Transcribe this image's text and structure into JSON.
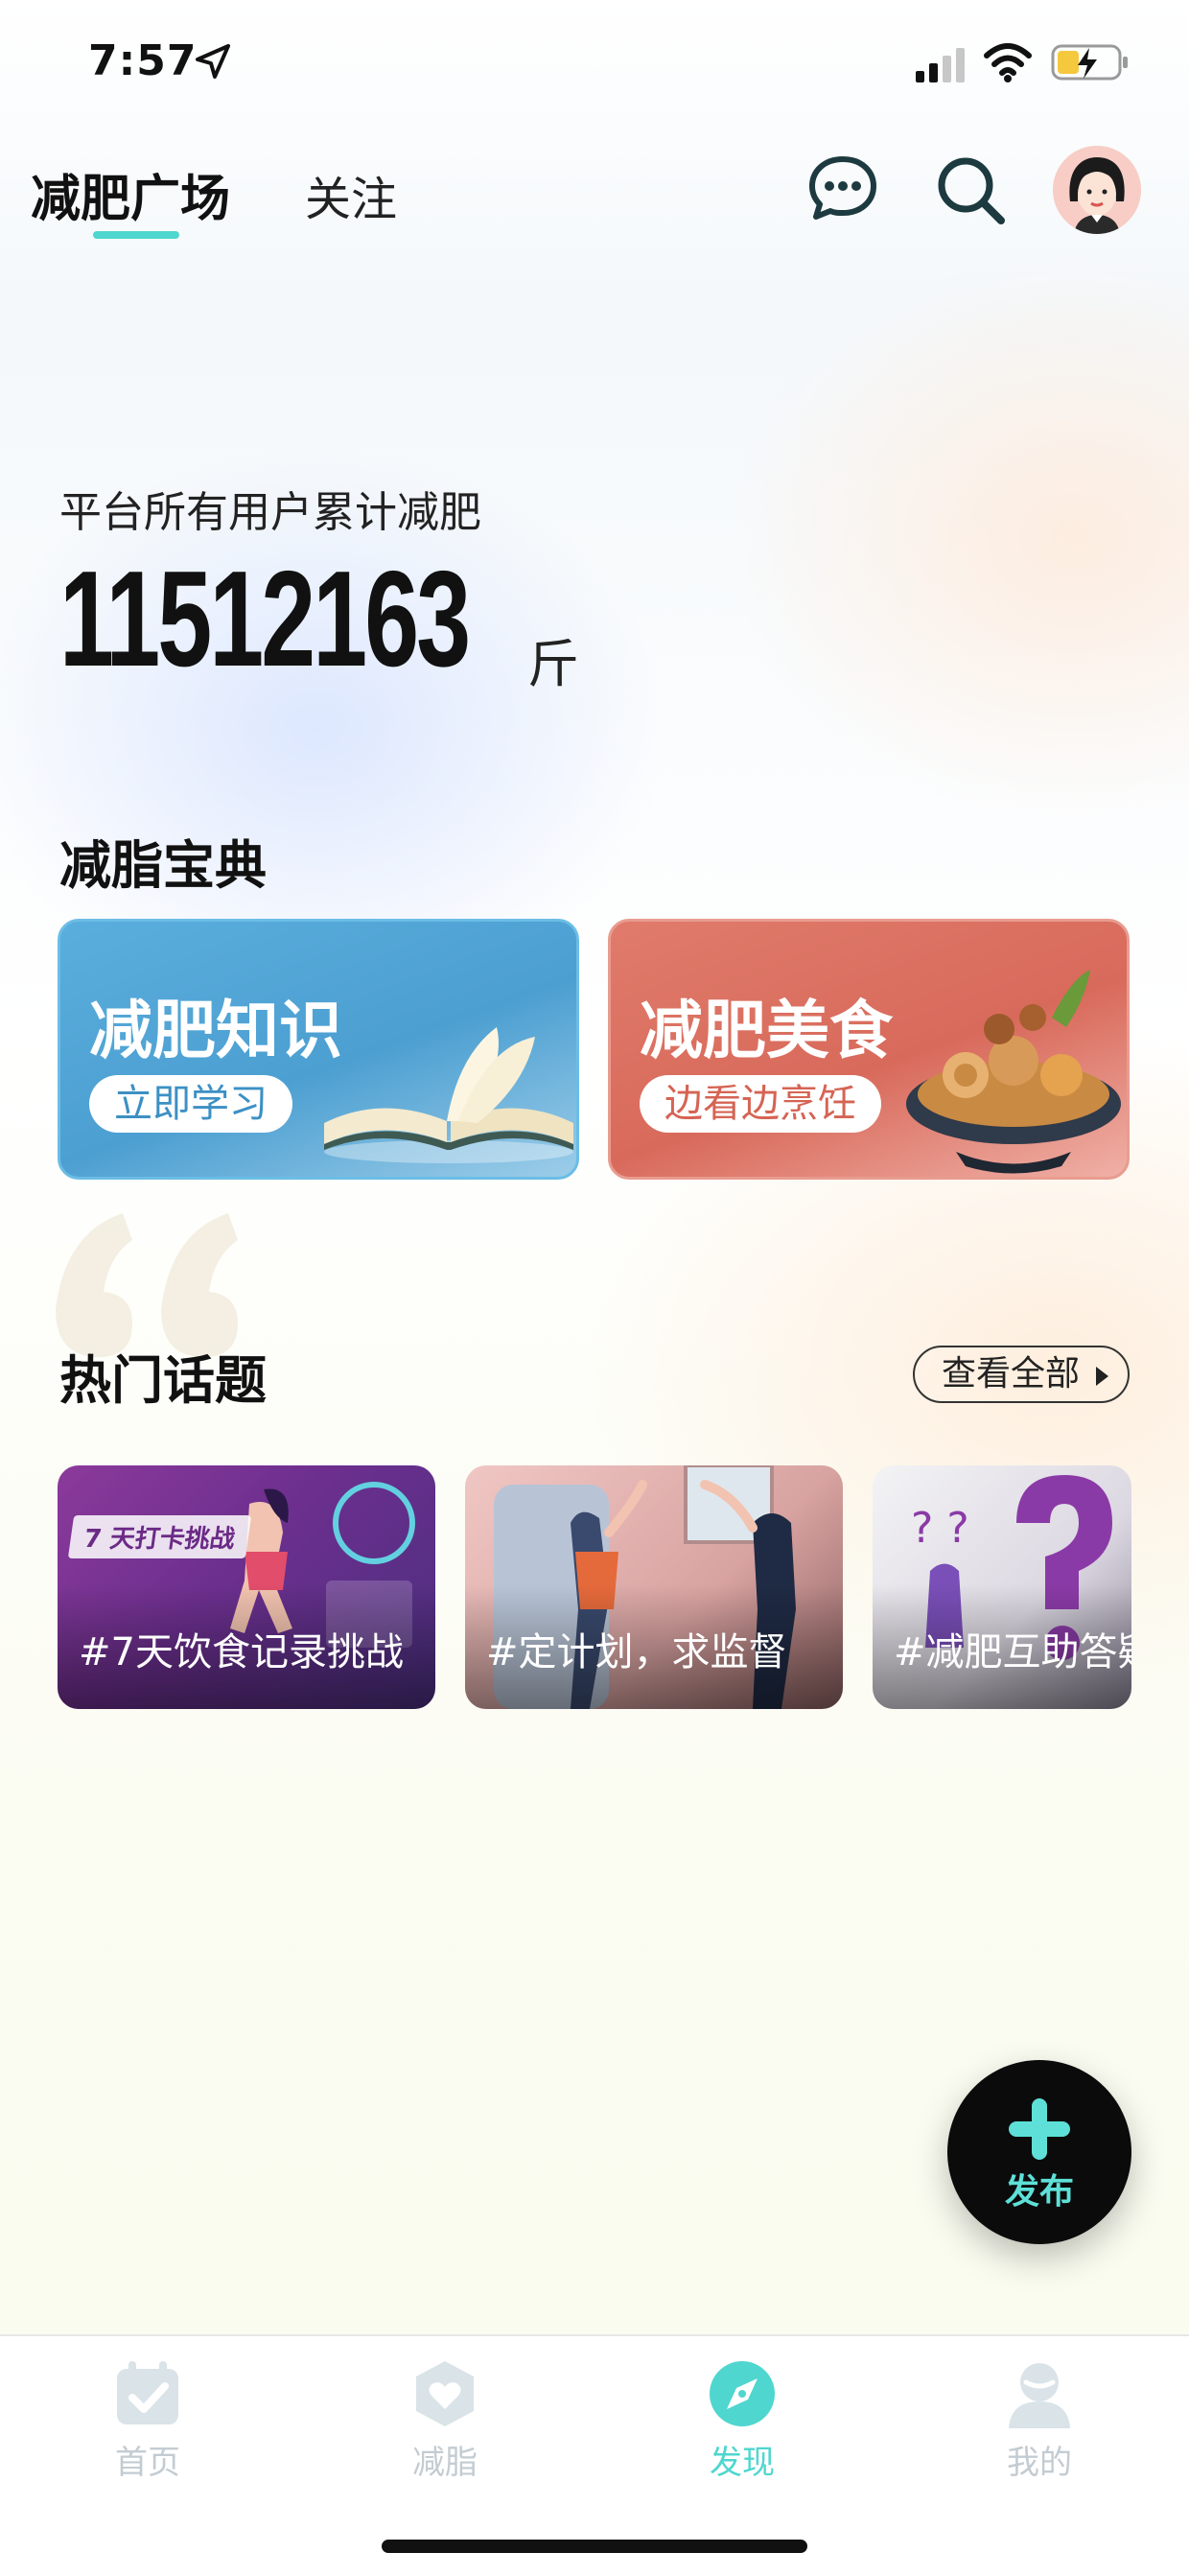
{
  "status_bar": {
    "time": "7:57",
    "icons": [
      "location-arrow-icon",
      "cellular-signal-icon",
      "wifi-icon",
      "battery-charging-icon"
    ]
  },
  "header": {
    "tabs": [
      {
        "label": "减肥广场",
        "active": true
      },
      {
        "label": "关注",
        "active": false
      }
    ],
    "accent_color": "#4fd6cf",
    "icons": [
      "message-icon",
      "search-icon",
      "avatar"
    ]
  },
  "stats": {
    "label": "平台所有用户累计减肥",
    "value": "11512163",
    "unit": "斤"
  },
  "guide": {
    "title": "减脂宝典",
    "cards": [
      {
        "title": "减肥知识",
        "button": "立即学习",
        "color": "#4c9fd1",
        "icon": "book-icon"
      },
      {
        "title": "减肥美食",
        "button": "边看边烹饪",
        "color": "#d86a5b",
        "icon": "hotpot-icon"
      }
    ]
  },
  "topics": {
    "title": "热门话题",
    "view_all": "查看全部",
    "items": [
      {
        "label": "#7天饮食记录挑战",
        "badge": "7 天打卡挑战"
      },
      {
        "label": "#定计划，求监督",
        "badge": ""
      },
      {
        "label": "#减肥互助答疑",
        "badge": ""
      }
    ]
  },
  "fab": {
    "label": "发布",
    "color": "#5ee0d8"
  },
  "bottom_nav": {
    "items": [
      {
        "label": "首页",
        "icon": "home-checklist-icon",
        "active": false
      },
      {
        "label": "减脂",
        "icon": "heart-shield-icon",
        "active": false
      },
      {
        "label": "发现",
        "icon": "compass-icon",
        "active": true
      },
      {
        "label": "我的",
        "icon": "profile-icon",
        "active": false
      }
    ]
  }
}
